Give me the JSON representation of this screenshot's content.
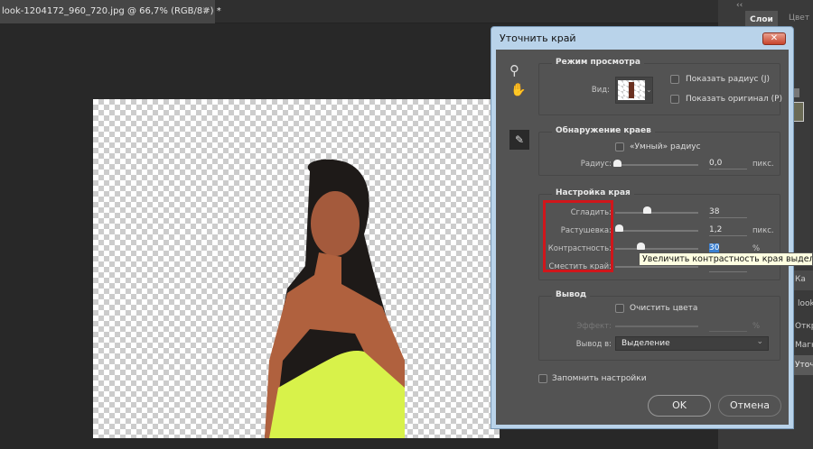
{
  "document": {
    "tab_title": "look-1204172_960_720.jpg @ 66,7% (RGB/8#) *",
    "close": "×"
  },
  "right_panel": {
    "collapse": "‹‹",
    "tabs": [
      "Слои",
      "Цвет"
    ],
    "items": [
      "Ка",
      "look",
      "Откр",
      "Магн",
      "Уточ"
    ]
  },
  "dialog": {
    "title": "Уточнить край",
    "close": "✕",
    "view_mode": {
      "title": "Режим просмотра",
      "view_label": "Вид:",
      "show_radius": "Показать радиус (J)",
      "show_original": "Показать оригинал (P)"
    },
    "edge_detection": {
      "title": "Обнаружение краев",
      "smart_radius": "«Умный» радиус",
      "radius_label": "Радиус:",
      "radius_value": "0,0",
      "radius_unit": "пикс."
    },
    "adjust_edge": {
      "title": "Настройка края",
      "smooth_label": "Сгладить:",
      "smooth_value": "38",
      "feather_label": "Растушевка:",
      "feather_value": "1,2",
      "feather_unit": "пикс.",
      "contrast_label": "Контрастность:",
      "contrast_value": "30",
      "contrast_unit": "%",
      "shift_label": "Сместить край:"
    },
    "tooltip": "Увеличить контрастность края выделенной",
    "output": {
      "title": "Вывод",
      "decontaminate": "Очистить цвета",
      "amount_label": "Эффект:",
      "amount_unit": "%",
      "output_to_label": "Вывод в:",
      "output_to_value": "Выделение"
    },
    "remember": "Запомнить настройки",
    "ok": "OK",
    "cancel": "Отмена",
    "highlight_color": "#d0161b"
  }
}
